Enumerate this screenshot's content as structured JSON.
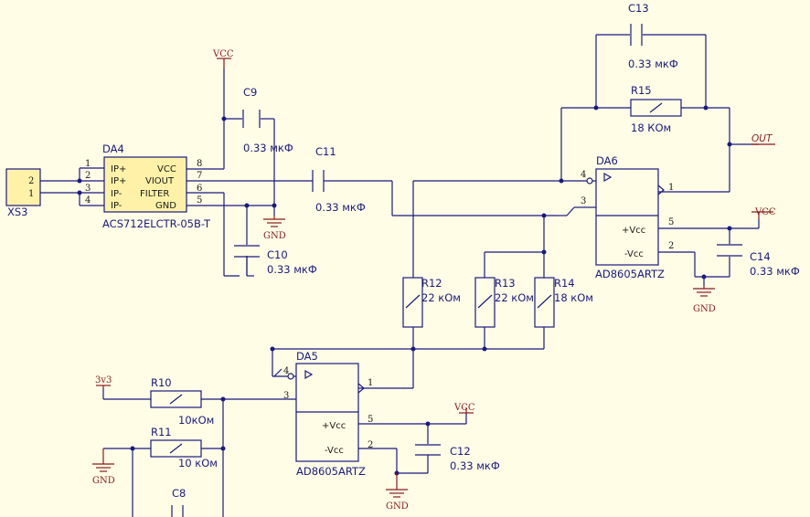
{
  "colors": {
    "background": "#fffde6",
    "wire": "#1a1a80",
    "power": "#8b1a1a",
    "chip_fill": "#fff2a8"
  },
  "net_label": "OUT",
  "power": {
    "vcc": "VCC",
    "gnd": "GND",
    "v33": "3v3"
  },
  "connector": {
    "ref": "XS3",
    "pin_top": "2",
    "pin_bottom": "1"
  },
  "da4": {
    "ref": "DA4",
    "part": "ACS712ELCTR-05B-T",
    "left_pins": [
      {
        "num": "1",
        "name": "IP+"
      },
      {
        "num": "2",
        "name": "IP+"
      },
      {
        "num": "3",
        "name": "IP-"
      },
      {
        "num": "4",
        "name": "IP-"
      }
    ],
    "right_pins": [
      {
        "num": "8",
        "name": "VCC"
      },
      {
        "num": "7",
        "name": "VIOUT"
      },
      {
        "num": "6",
        "name": "FILTER"
      },
      {
        "num": "5",
        "name": "GND"
      }
    ]
  },
  "da5": {
    "ref": "DA5",
    "part": "AD8605ARTZ",
    "pin_in_neg": "4",
    "pin_in_pos": "3",
    "pin_out": "1",
    "pin_vp": "5",
    "pin_vn": "2",
    "label_vp": "+Vcc",
    "label_vn": "-Vcc"
  },
  "da6": {
    "ref": "DA6",
    "part": "AD8605ARTZ",
    "pin_in_neg": "4",
    "pin_in_pos": "3",
    "pin_out": "1",
    "pin_vp": "5",
    "pin_vn": "2",
    "label_vp": "+Vcc",
    "label_vn": "-Vcc"
  },
  "components": {
    "C8": {
      "ref": "C8"
    },
    "C9": {
      "ref": "C9",
      "value": "0.33 мкФ"
    },
    "C10": {
      "ref": "C10",
      "value": "0.33 мкФ"
    },
    "C11": {
      "ref": "C11",
      "value": "0.33 мкФ"
    },
    "C12": {
      "ref": "C12",
      "value": "0.33 мкФ"
    },
    "C13": {
      "ref": "C13",
      "value": "0.33 мкФ"
    },
    "C14": {
      "ref": "C14",
      "value": "0.33 мкФ"
    },
    "R10": {
      "ref": "R10",
      "value": "10кОм"
    },
    "R11": {
      "ref": "R11",
      "value": "10 кОм"
    },
    "R12": {
      "ref": "R12",
      "value": "22 кОм"
    },
    "R13": {
      "ref": "R13",
      "value": "22 кОм"
    },
    "R14": {
      "ref": "R14",
      "value": "18 кОм"
    },
    "R15": {
      "ref": "R15",
      "value": "18 КОм"
    }
  }
}
